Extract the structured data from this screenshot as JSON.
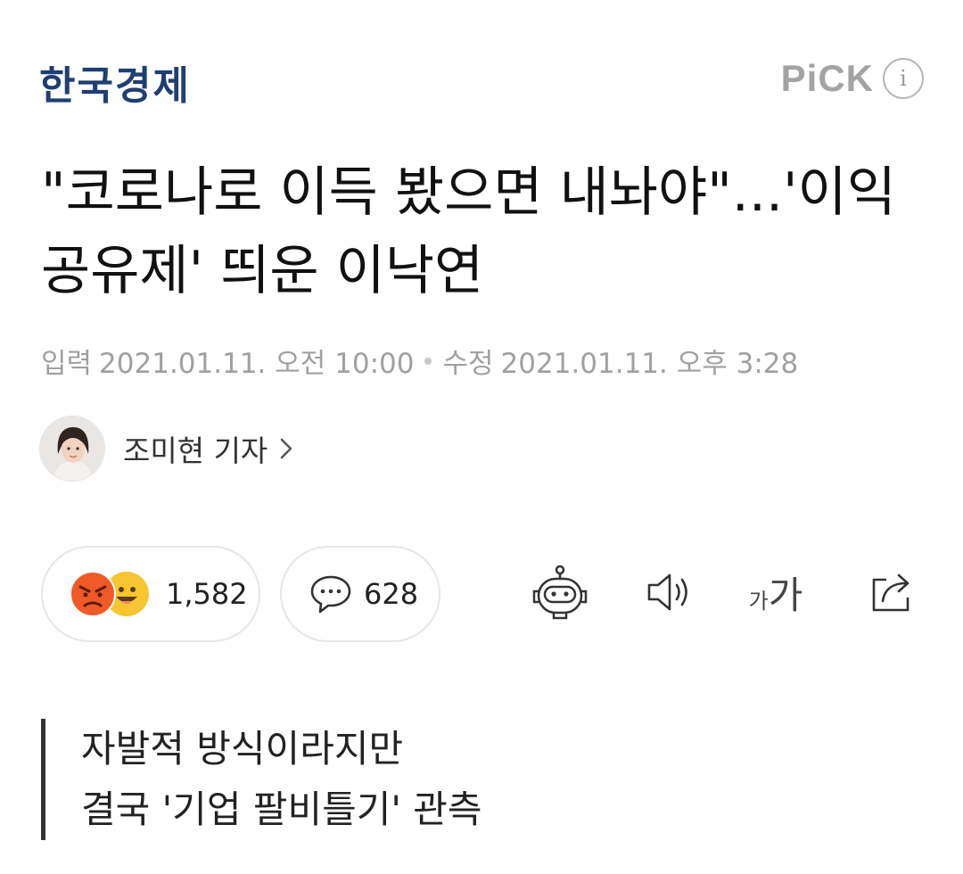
{
  "header": {
    "logo": "한국경제",
    "pick_label": "PiCK",
    "info_label": "i"
  },
  "article": {
    "headline": "\"코로나로 이득 봤으면 내놔야\"...'이익공유제' 띄운 이낙연",
    "input_label": "입력",
    "input_date": "2021.01.11. 오전 10:00",
    "modified_label": "수정",
    "modified_date": "2021.01.11. 오후 3:28"
  },
  "reporter": {
    "name": "조미현 기자"
  },
  "actions": {
    "reaction_count": "1,582",
    "comment_count": "628",
    "font_size_small": "가",
    "font_size_large": "가"
  },
  "subheadings": [
    "자발적 방식이라지만",
    "결국 '기업 팔비틀기' 관측"
  ],
  "colors": {
    "logo": "#1f3f73",
    "pick": "#a3a3a3",
    "meta": "#a0a0a0",
    "angry_emoji": "#f05a28",
    "smile_emoji": "#f7c531"
  },
  "icons": [
    "info-icon",
    "chevron-right-icon",
    "angry-emoji-icon",
    "smile-emoji-icon",
    "comment-icon",
    "robot-summary-icon",
    "speaker-icon",
    "font-size-icon",
    "share-icon"
  ]
}
